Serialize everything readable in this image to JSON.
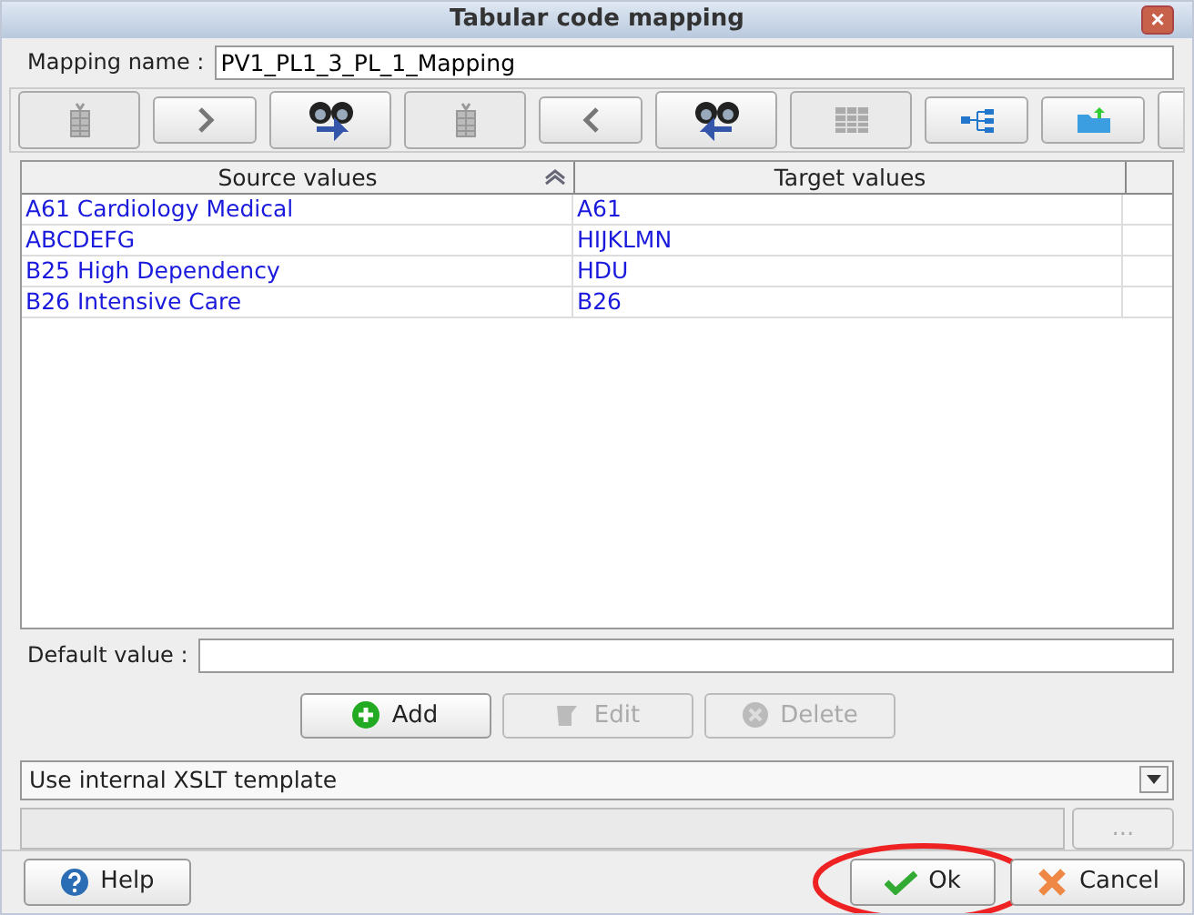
{
  "window": {
    "title": "Tabular code mapping",
    "close": "×"
  },
  "mapping_name": {
    "label": "Mapping name :",
    "value": "PV1_PL1_3_PL_1_Mapping"
  },
  "toolbar": [
    {
      "kind": "list-down",
      "disabled": true
    },
    {
      "kind": "chevron-right",
      "disabled": false
    },
    {
      "kind": "binoculars-right",
      "disabled": false
    },
    {
      "kind": "list-down",
      "disabled": true
    },
    {
      "kind": "chevron-left",
      "disabled": false
    },
    {
      "kind": "binoculars-left",
      "disabled": false
    },
    {
      "kind": "grid",
      "disabled": true
    },
    {
      "kind": "tree",
      "disabled": false
    },
    {
      "kind": "folder",
      "disabled": false
    },
    {
      "kind": "partial",
      "disabled": false
    }
  ],
  "table": {
    "columns": [
      {
        "label": "Source values",
        "sorted": true
      },
      {
        "label": "Target values",
        "sorted": false
      }
    ],
    "rows": [
      [
        "A61 Cardiology Medical",
        "A61"
      ],
      [
        "ABCDEFG",
        "HIJKLMN"
      ],
      [
        "B25 High Dependency",
        "HDU"
      ],
      [
        "B26 Intensive Care",
        "B26"
      ]
    ]
  },
  "default_value": {
    "label": "Default value :"
  },
  "actions": [
    {
      "label": "Add",
      "kind": "add",
      "disabled": false
    },
    {
      "label": "Edit",
      "kind": "edit",
      "disabled": true
    },
    {
      "label": "Delete",
      "kind": "delete",
      "disabled": true
    }
  ],
  "template": {
    "value": "Use internal XSLT template"
  },
  "browse": {
    "label": "...",
    "disabled": true
  },
  "footer": [
    {
      "label": "Help",
      "kind": "help",
      "highlighted": false
    },
    {
      "label": "Ok",
      "kind": "ok",
      "highlighted": true
    },
    {
      "label": "Cancel",
      "kind": "cancel",
      "highlighted": false
    }
  ]
}
